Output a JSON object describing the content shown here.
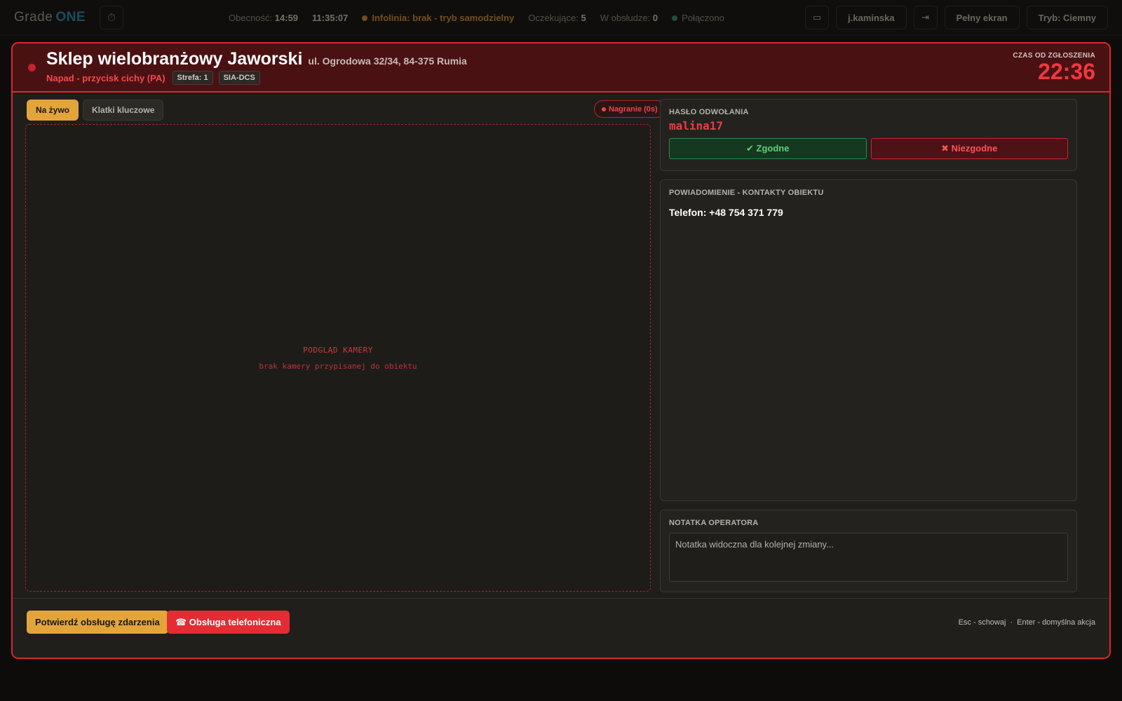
{
  "topbar": {
    "logo_text": "Grade",
    "logo_accent": "ONE",
    "timer_icon": "⏱",
    "presence_label": "Obecność:",
    "presence_value": "14:59",
    "clock": "11:35:07",
    "infoline": "Infolinia: brak - tryb samodzielny",
    "pending_label": "Oczekujące:",
    "pending_value": "5",
    "in_service_label": "W obsłudze:",
    "in_service_value": "0",
    "connection": "Połączono",
    "camera_icon": "▭",
    "user": "j.kaminska",
    "logout_icon": "⇥",
    "fullscreen": "Pełny ekran",
    "theme": "Tryb: Ciemny"
  },
  "modal": {
    "title": "Sklep wielobranżowy Jaworski",
    "address": "ul. Ogrodowa 32/34, 84-375 Rumia",
    "alarm_type": "Napad - przycisk cichy (PA)",
    "zone": "Strefa: 1",
    "protocol": "SIA-DCS",
    "time_label": "CZAS OD ZGŁOSZENIA",
    "time_value": "22:36"
  },
  "camera": {
    "tabs": [
      "Na żywo",
      "Klatki kluczowe"
    ],
    "recording": "Nagranie (0s)",
    "placeholder_title": "PODGLĄD KAMERY",
    "placeholder_sub": "brak kamery przypisanej do obiektu"
  },
  "password_panel": {
    "label": "HASŁO ODWOŁANIA",
    "value": "malina17",
    "match": "✔ Zgodne",
    "mismatch": "✖ Niezgodne"
  },
  "contacts_panel": {
    "label": "POWIADOMIENIE - KONTAKTY OBIEKTU",
    "phone": "Telefon: +48 754 371 779"
  },
  "note_panel": {
    "label": "NOTATKA OPERATORA",
    "placeholder": "Notatka widoczna dla kolejnej zmiany..."
  },
  "footer": {
    "confirm": "Potwierdź obsługę zdarzenia",
    "phone": "☎ Obsługa telefoniczna",
    "hint_esc": "Esc - schowaj",
    "hint_sep": "·",
    "hint_enter": "Enter - domyślna akcja"
  },
  "colors": {
    "accent": "#e3a53a",
    "alarm": "#d8282e",
    "ok": "#2d8847",
    "connected": "#2e8a57",
    "infoline": "#c5862b"
  }
}
